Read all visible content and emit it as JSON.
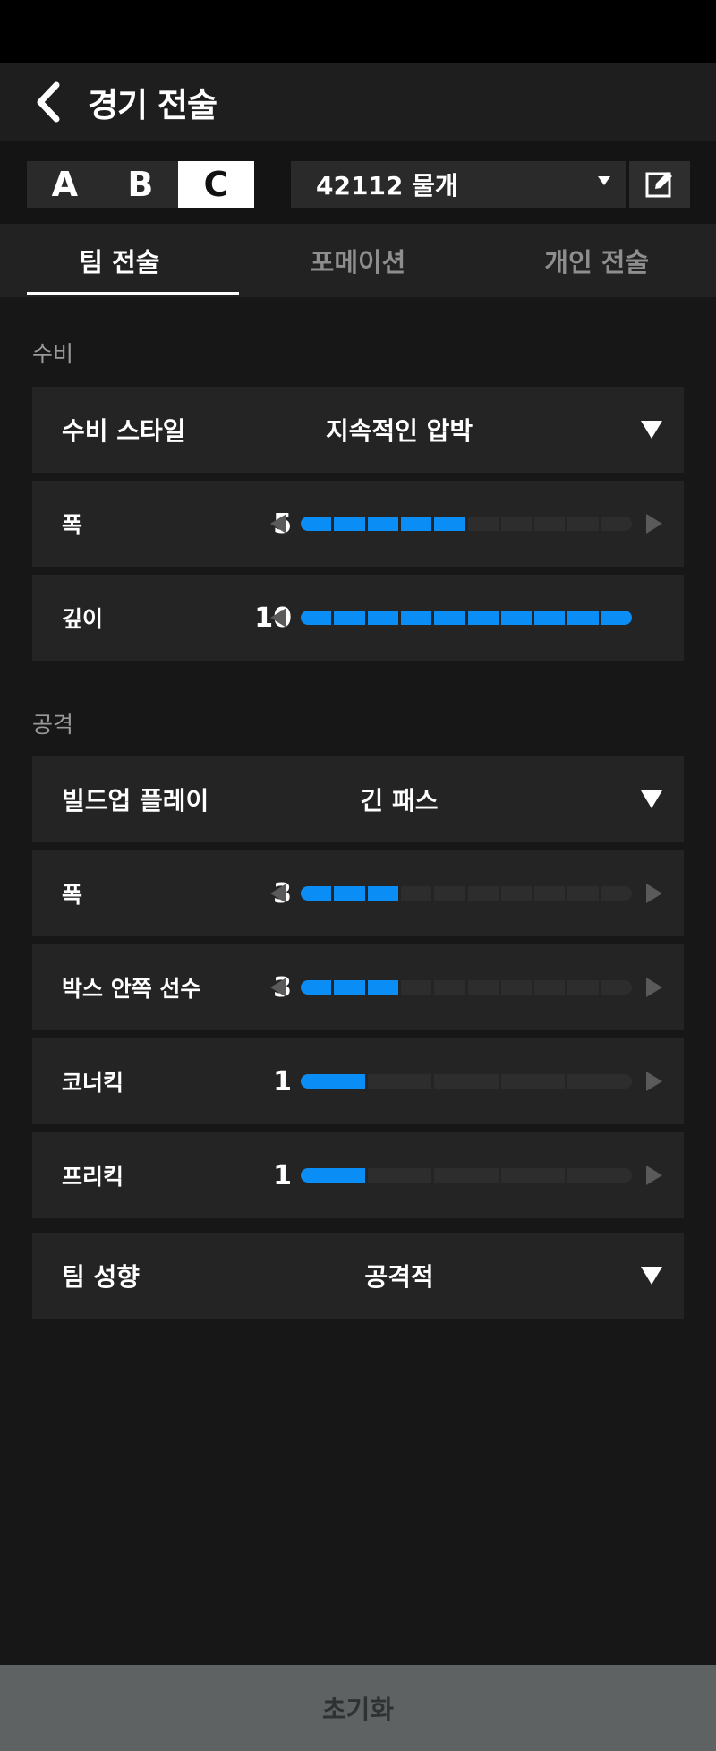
{
  "header": {
    "title": "경기 전술"
  },
  "presets": [
    "A",
    "B",
    "C"
  ],
  "active_preset": "C",
  "formation": {
    "value": "42112 물개"
  },
  "tabs": [
    {
      "label": "팀 전술",
      "active": true
    },
    {
      "label": "포메이션",
      "active": false
    },
    {
      "label": "개인 전술",
      "active": false
    }
  ],
  "defense": {
    "title": "수비",
    "style": {
      "label": "수비 스타일",
      "value": "지속적인 압박"
    },
    "width": {
      "label": "폭",
      "value": "5",
      "level": 5,
      "max": 10
    },
    "depth": {
      "label": "깊이",
      "value": "10",
      "level": 10,
      "max": 10
    }
  },
  "attack": {
    "title": "공격",
    "buildup": {
      "label": "빌드업 플레이",
      "value": "긴 패스"
    },
    "width": {
      "label": "폭",
      "value": "3",
      "level": 3,
      "max": 10
    },
    "box_players": {
      "label": "박스 안쪽 선수",
      "value": "3",
      "level": 3,
      "max": 10
    },
    "corner": {
      "label": "코너킥",
      "value": "1",
      "level": 1,
      "max": 5
    },
    "freekick": {
      "label": "프리킥",
      "value": "1",
      "level": 1,
      "max": 5
    },
    "team_tendency": {
      "label": "팀 성향",
      "value": "공격적"
    }
  },
  "footer": {
    "reset_label": "초기화"
  },
  "colors": {
    "accent": "#0a8ef5",
    "bar_empty": "#2d2d2d"
  }
}
